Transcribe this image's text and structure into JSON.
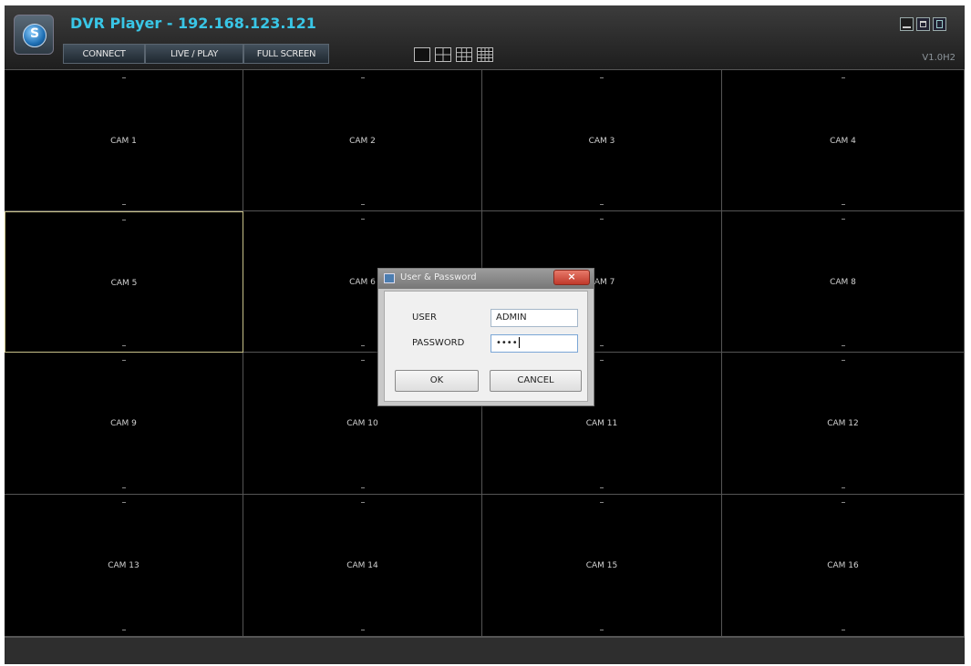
{
  "app": {
    "title": "DVR Player - 192.168.123.121",
    "version": "V1.0H2",
    "logo_letter": "S"
  },
  "toolbar": {
    "connect_label": "CONNECT",
    "live_play_label": "LIVE / PLAY",
    "full_screen_label": "FULL SCREEN"
  },
  "layouts": [
    "1",
    "4",
    "9",
    "16"
  ],
  "window_controls": [
    "minimize",
    "maximize",
    "close"
  ],
  "grid": {
    "rows": 4,
    "cols": 4,
    "selected": "CAM 5",
    "cameras": [
      "CAM 1",
      "CAM 2",
      "CAM 3",
      "CAM 4",
      "CAM 5",
      "CAM 6",
      "CAM 7",
      "CAM 8",
      "CAM 9",
      "CAM 10",
      "CAM 11",
      "CAM 12",
      "CAM 13",
      "CAM 14",
      "CAM 15",
      "CAM 16"
    ]
  },
  "dialog": {
    "title": "User & Password",
    "close_glyph": "×",
    "user_label": "USER",
    "user_value": "ADMIN",
    "password_label": "PASSWORD",
    "password_mask": "••••",
    "ok_label": "OK",
    "cancel_label": "CANCEL"
  },
  "colors": {
    "title_accent": "#39c6e6",
    "selected_cell_border": "#c9c28a",
    "close_button": "#c0392b"
  }
}
